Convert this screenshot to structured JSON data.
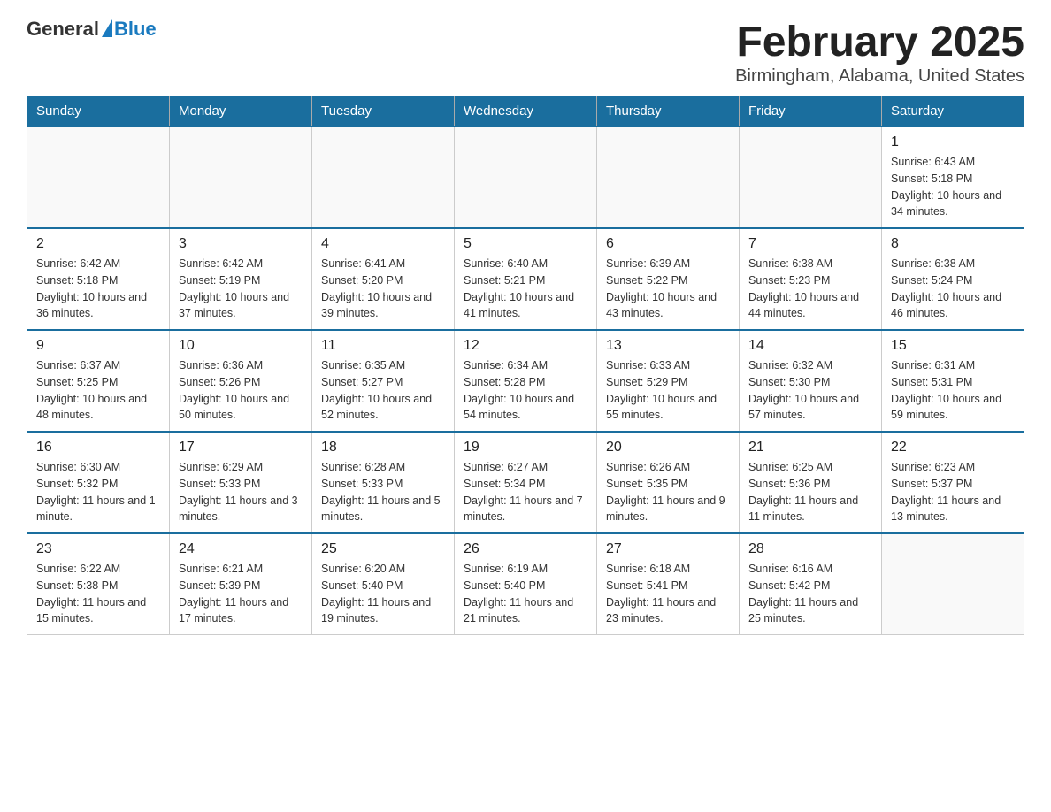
{
  "header": {
    "logo_general": "General",
    "logo_blue": "Blue",
    "title": "February 2025",
    "subtitle": "Birmingham, Alabama, United States"
  },
  "days_of_week": [
    "Sunday",
    "Monday",
    "Tuesday",
    "Wednesday",
    "Thursday",
    "Friday",
    "Saturday"
  ],
  "weeks": [
    [
      {
        "day": "",
        "info": ""
      },
      {
        "day": "",
        "info": ""
      },
      {
        "day": "",
        "info": ""
      },
      {
        "day": "",
        "info": ""
      },
      {
        "day": "",
        "info": ""
      },
      {
        "day": "",
        "info": ""
      },
      {
        "day": "1",
        "info": "Sunrise: 6:43 AM\nSunset: 5:18 PM\nDaylight: 10 hours and 34 minutes."
      }
    ],
    [
      {
        "day": "2",
        "info": "Sunrise: 6:42 AM\nSunset: 5:18 PM\nDaylight: 10 hours and 36 minutes."
      },
      {
        "day": "3",
        "info": "Sunrise: 6:42 AM\nSunset: 5:19 PM\nDaylight: 10 hours and 37 minutes."
      },
      {
        "day": "4",
        "info": "Sunrise: 6:41 AM\nSunset: 5:20 PM\nDaylight: 10 hours and 39 minutes."
      },
      {
        "day": "5",
        "info": "Sunrise: 6:40 AM\nSunset: 5:21 PM\nDaylight: 10 hours and 41 minutes."
      },
      {
        "day": "6",
        "info": "Sunrise: 6:39 AM\nSunset: 5:22 PM\nDaylight: 10 hours and 43 minutes."
      },
      {
        "day": "7",
        "info": "Sunrise: 6:38 AM\nSunset: 5:23 PM\nDaylight: 10 hours and 44 minutes."
      },
      {
        "day": "8",
        "info": "Sunrise: 6:38 AM\nSunset: 5:24 PM\nDaylight: 10 hours and 46 minutes."
      }
    ],
    [
      {
        "day": "9",
        "info": "Sunrise: 6:37 AM\nSunset: 5:25 PM\nDaylight: 10 hours and 48 minutes."
      },
      {
        "day": "10",
        "info": "Sunrise: 6:36 AM\nSunset: 5:26 PM\nDaylight: 10 hours and 50 minutes."
      },
      {
        "day": "11",
        "info": "Sunrise: 6:35 AM\nSunset: 5:27 PM\nDaylight: 10 hours and 52 minutes."
      },
      {
        "day": "12",
        "info": "Sunrise: 6:34 AM\nSunset: 5:28 PM\nDaylight: 10 hours and 54 minutes."
      },
      {
        "day": "13",
        "info": "Sunrise: 6:33 AM\nSunset: 5:29 PM\nDaylight: 10 hours and 55 minutes."
      },
      {
        "day": "14",
        "info": "Sunrise: 6:32 AM\nSunset: 5:30 PM\nDaylight: 10 hours and 57 minutes."
      },
      {
        "day": "15",
        "info": "Sunrise: 6:31 AM\nSunset: 5:31 PM\nDaylight: 10 hours and 59 minutes."
      }
    ],
    [
      {
        "day": "16",
        "info": "Sunrise: 6:30 AM\nSunset: 5:32 PM\nDaylight: 11 hours and 1 minute."
      },
      {
        "day": "17",
        "info": "Sunrise: 6:29 AM\nSunset: 5:33 PM\nDaylight: 11 hours and 3 minutes."
      },
      {
        "day": "18",
        "info": "Sunrise: 6:28 AM\nSunset: 5:33 PM\nDaylight: 11 hours and 5 minutes."
      },
      {
        "day": "19",
        "info": "Sunrise: 6:27 AM\nSunset: 5:34 PM\nDaylight: 11 hours and 7 minutes."
      },
      {
        "day": "20",
        "info": "Sunrise: 6:26 AM\nSunset: 5:35 PM\nDaylight: 11 hours and 9 minutes."
      },
      {
        "day": "21",
        "info": "Sunrise: 6:25 AM\nSunset: 5:36 PM\nDaylight: 11 hours and 11 minutes."
      },
      {
        "day": "22",
        "info": "Sunrise: 6:23 AM\nSunset: 5:37 PM\nDaylight: 11 hours and 13 minutes."
      }
    ],
    [
      {
        "day": "23",
        "info": "Sunrise: 6:22 AM\nSunset: 5:38 PM\nDaylight: 11 hours and 15 minutes."
      },
      {
        "day": "24",
        "info": "Sunrise: 6:21 AM\nSunset: 5:39 PM\nDaylight: 11 hours and 17 minutes."
      },
      {
        "day": "25",
        "info": "Sunrise: 6:20 AM\nSunset: 5:40 PM\nDaylight: 11 hours and 19 minutes."
      },
      {
        "day": "26",
        "info": "Sunrise: 6:19 AM\nSunset: 5:40 PM\nDaylight: 11 hours and 21 minutes."
      },
      {
        "day": "27",
        "info": "Sunrise: 6:18 AM\nSunset: 5:41 PM\nDaylight: 11 hours and 23 minutes."
      },
      {
        "day": "28",
        "info": "Sunrise: 6:16 AM\nSunset: 5:42 PM\nDaylight: 11 hours and 25 minutes."
      },
      {
        "day": "",
        "info": ""
      }
    ]
  ]
}
